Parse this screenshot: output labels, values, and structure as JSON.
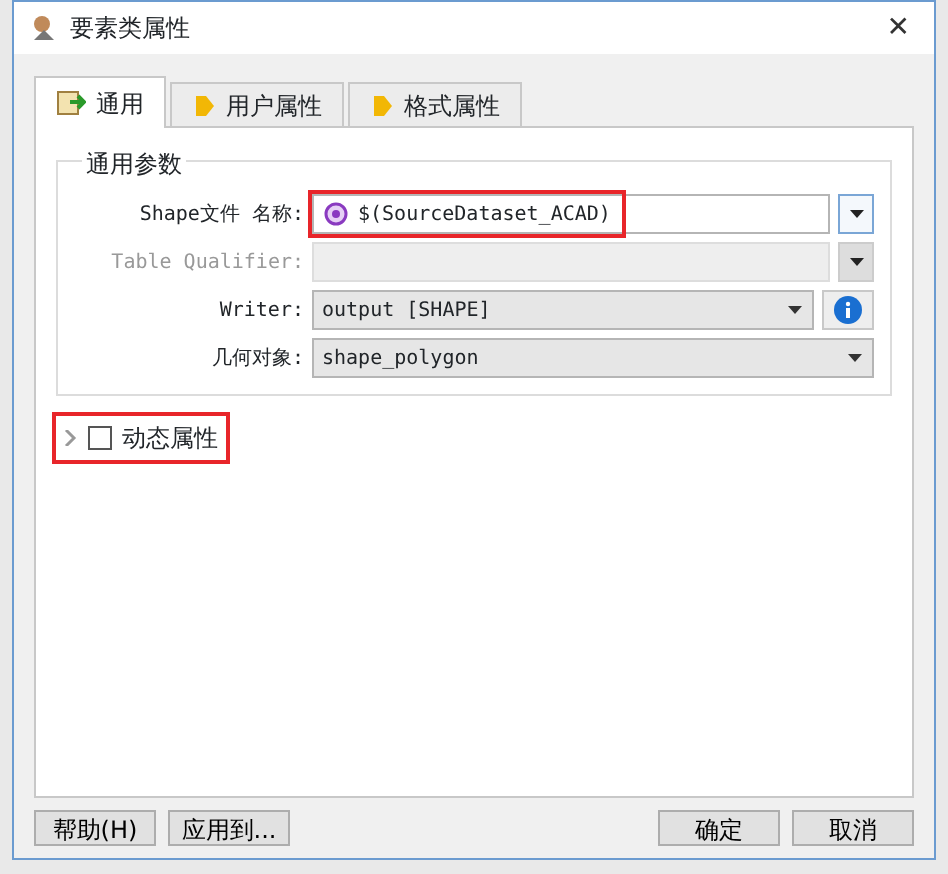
{
  "window": {
    "title": "要素类属性",
    "close": "✕"
  },
  "tabs": [
    {
      "label": "通用",
      "selected": true,
      "kind": "general"
    },
    {
      "label": "用户属性",
      "selected": false,
      "kind": "bullet"
    },
    {
      "label": "格式属性",
      "selected": false,
      "kind": "bullet"
    }
  ],
  "group": {
    "title": "通用参数",
    "fields": [
      {
        "label": "Shape文件 名称:",
        "value": "$(SourceDataset_ACAD)",
        "kind": "param",
        "disabled": false,
        "highlighted": true
      },
      {
        "label": "Table Qualifier:",
        "kind": "param",
        "disabled": true,
        "highlighted": false
      },
      {
        "label": "Writer:",
        "value": "output [SHAPE]",
        "kind": "select-info",
        "disabled": false,
        "highlighted": false
      },
      {
        "label": "几何对象:",
        "value": "shape_polygon",
        "kind": "select",
        "disabled": false,
        "highlighted": false
      }
    ]
  },
  "dynamic": {
    "label": "动态属性",
    "checked": false,
    "expanded": false,
    "highlighted": true
  },
  "left_buttons": [
    "帮助(H)",
    "应用到..."
  ],
  "right_buttons": [
    "确定",
    "取消"
  ]
}
